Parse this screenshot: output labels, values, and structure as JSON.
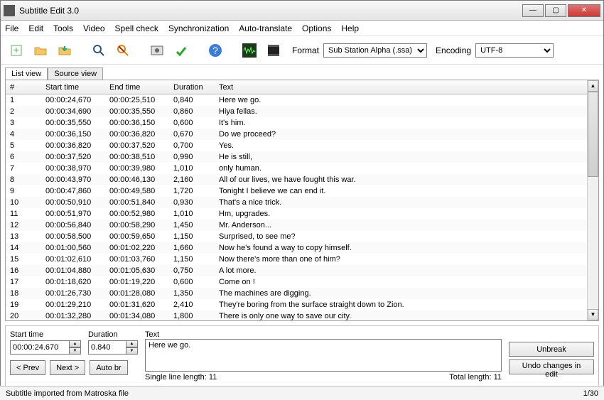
{
  "window": {
    "title": "Subtitle Edit 3.0"
  },
  "menu": [
    "File",
    "Edit",
    "Tools",
    "Video",
    "Spell check",
    "Synchronization",
    "Auto-translate",
    "Options",
    "Help"
  ],
  "toolbar": {
    "format_label": "Format",
    "format_value": "Sub Station Alpha (.ssa)",
    "encoding_label": "Encoding",
    "encoding_value": "UTF-8"
  },
  "tabs": {
    "list": "List view",
    "source": "Source view"
  },
  "columns": {
    "n": "#",
    "start": "Start time",
    "end": "End time",
    "dur": "Duration",
    "text": "Text"
  },
  "rows": [
    {
      "n": "1",
      "s": "00:00:24,670",
      "e": "00:00:25,510",
      "d": "0,840",
      "t": "Here we go."
    },
    {
      "n": "2",
      "s": "00:00:34,690",
      "e": "00:00:35,550",
      "d": "0,860",
      "t": "Hiya fellas."
    },
    {
      "n": "3",
      "s": "00:00:35,550",
      "e": "00:00:36,150",
      "d": "0,600",
      "t": "It's him."
    },
    {
      "n": "4",
      "s": "00:00:36,150",
      "e": "00:00:36,820",
      "d": "0,670",
      "t": "Do we proceed?"
    },
    {
      "n": "5",
      "s": "00:00:36,820",
      "e": "00:00:37,520",
      "d": "0,700",
      "t": "Yes."
    },
    {
      "n": "6",
      "s": "00:00:37,520",
      "e": "00:00:38,510",
      "d": "0,990",
      "t": "He is still,"
    },
    {
      "n": "7",
      "s": "00:00:38,970",
      "e": "00:00:39,980",
      "d": "1,010",
      "t": "only human."
    },
    {
      "n": "8",
      "s": "00:00:43,970",
      "e": "00:00:46,130",
      "d": "2,160",
      "t": "All of our lives, we have fought this war."
    },
    {
      "n": "9",
      "s": "00:00:47,860",
      "e": "00:00:49,580",
      "d": "1,720",
      "t": "Tonight I believe we can end it."
    },
    {
      "n": "10",
      "s": "00:00:50,910",
      "e": "00:00:51,840",
      "d": "0,930",
      "t": "That's a nice trick."
    },
    {
      "n": "11",
      "s": "00:00:51,970",
      "e": "00:00:52,980",
      "d": "1,010",
      "t": "Hm, upgrades."
    },
    {
      "n": "12",
      "s": "00:00:56,840",
      "e": "00:00:58,290",
      "d": "1,450",
      "t": "Mr. Anderson..."
    },
    {
      "n": "13",
      "s": "00:00:58,500",
      "e": "00:00:59,650",
      "d": "1,150",
      "t": "Surprised, to see me?"
    },
    {
      "n": "14",
      "s": "00:01:00,560",
      "e": "00:01:02,220",
      "d": "1,660",
      "t": "Now he's found a way to copy himself."
    },
    {
      "n": "15",
      "s": "00:01:02,610",
      "e": "00:01:03,760",
      "d": "1,150",
      "t": "Now there's more than one of him?"
    },
    {
      "n": "16",
      "s": "00:01:04,880",
      "e": "00:01:05,630",
      "d": "0,750",
      "t": "A lot more."
    },
    {
      "n": "17",
      "s": "00:01:18,620",
      "e": "00:01:19,220",
      "d": "0,600",
      "t": "Come on !"
    },
    {
      "n": "18",
      "s": "00:01:26,730",
      "e": "00:01:28,080",
      "d": "1,350",
      "t": "The machines are digging."
    },
    {
      "n": "19",
      "s": "00:01:29,210",
      "e": "00:01:31,620",
      "d": "2,410",
      "t": "They're boring from the surface straight down to Zion."
    },
    {
      "n": "20",
      "s": "00:01:32,280",
      "e": "00:01:34,080",
      "d": "1,800",
      "t": "There is only one way to save our city."
    }
  ],
  "edit": {
    "start_label": "Start time",
    "start_value": "00:00:24.670",
    "dur_label": "Duration",
    "dur_value": "0.840",
    "text_label": "Text",
    "text_value": "Here we go.",
    "prev": "< Prev",
    "next": "Next >",
    "autobr": "Auto br",
    "unbreak": "Unbreak",
    "undo": "Undo changes in edit",
    "single_len": "Single line length:  11",
    "total_len": "Total length:  11"
  },
  "status": {
    "left": "Subtitle imported from Matroska file",
    "right": "1/30"
  }
}
